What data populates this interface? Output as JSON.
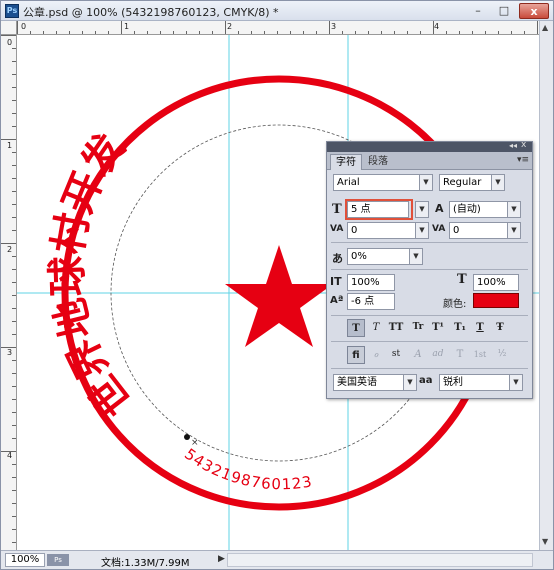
{
  "window": {
    "title": "公章.psd @ 100% (5432198760123, CMYK/8) *",
    "logo_label": "Ps",
    "minimize_label": "–",
    "maximize_label": "□",
    "close_label": "x"
  },
  "rulers": {
    "horizontal_labels": [
      "0",
      "1",
      "2",
      "3",
      "4"
    ],
    "vertical_labels": [
      "0",
      "1",
      "2",
      "3",
      "4"
    ]
  },
  "stamp": {
    "arc_text": "世界地球村开发",
    "serial_number": "5432198760123",
    "color": "#e60012"
  },
  "status": {
    "zoom": "100%",
    "doc_info": "文档:1.33M/7.99M",
    "arrow": "▶"
  },
  "panel": {
    "collapse_label": "◂◂",
    "close_label": "x",
    "menu_label": "▾≡",
    "tabs": [
      {
        "label": "字符",
        "active": true
      },
      {
        "label": "段落",
        "active": false
      }
    ],
    "font_family": "Arial",
    "font_style": "Regular",
    "font_size": "5 点",
    "leading": "(自动)",
    "kerning": "0",
    "tracking": "0",
    "vertical_scale": "100%",
    "horizontal_scale": "100%",
    "tsume": "0%",
    "baseline_shift": "-6 点",
    "color_label": "颜色:",
    "color_value": "#e60012",
    "language": "美国英语",
    "anti_alias": "锐利",
    "aa_label": "aa",
    "style_buttons": [
      "T",
      "T",
      "TT",
      "Tr",
      "T¹",
      "T₁",
      "T",
      "Ŧ"
    ],
    "opentype_buttons": [
      "fi",
      "ℴ",
      "st",
      "A",
      "ad",
      "T",
      "1st",
      "½"
    ]
  }
}
